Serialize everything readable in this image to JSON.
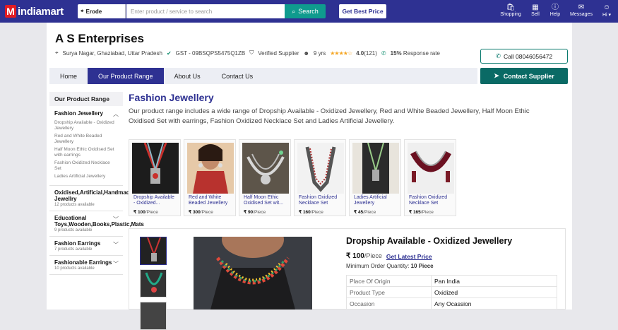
{
  "header": {
    "logo_text": "indiamart",
    "location": "Erode",
    "search_placeholder": "Enter product / service to search",
    "search_button": "Search",
    "best_price_button": "Get Best Price",
    "nav": [
      {
        "label": "Shopping",
        "icon": "cart-icon"
      },
      {
        "label": "Sell",
        "icon": "store-icon"
      },
      {
        "label": "Help",
        "icon": "help-icon"
      },
      {
        "label": "Messages",
        "icon": "messages-icon"
      },
      {
        "label": "Hi",
        "icon": "user-icon"
      }
    ]
  },
  "company": {
    "name": "A S Enterprises",
    "address": "Surya Nagar, Ghaziabad, Uttar Pradesh",
    "gst": "GST - 09BSQPS5475Q1ZB",
    "verified": "Verified Supplier",
    "years": "9 yrs",
    "rating": "4.0",
    "rating_count": "(121)",
    "response_pct": "15%",
    "response_label": "Response rate",
    "call_button": "Call 08046056472",
    "contact_button": "Contact Supplier"
  },
  "tabs": [
    "Home",
    "Our Product Range",
    "About Us",
    "Contact Us"
  ],
  "sidebar": {
    "heading": "Our Product Range",
    "categories": [
      {
        "title": "Fashion Jewellery",
        "count": "",
        "subs": [
          "Dropship Available - Oxidized Jewellery",
          "Red and White Beaded Jewellery",
          "Half Moon Ethic Oxidised Set with earrings",
          "Fashion Oxidized Necklace Set",
          "Ladies Artificial Jewellery"
        ]
      },
      {
        "title": "Oxidised,Artificial,Handmade Jewellry",
        "count": "12 products available",
        "subs": []
      },
      {
        "title": "Educational Toys,Wooden,Books,Plastic,Mats",
        "count": "9 products available",
        "subs": []
      },
      {
        "title": "Fashion Earrings",
        "count": "7 products available",
        "subs": []
      },
      {
        "title": "Fashionable Earrings",
        "count": "10 products available",
        "subs": []
      }
    ]
  },
  "main": {
    "heading": "Fashion Jewellery",
    "description": "Our product range includes a wide range of Dropship Available - Oxidized Jewellery, Red and White Beaded Jewellery, Half Moon Ethic Oxidised Set with earrings, Fashion Oxidized Necklace Set and Ladies Artificial Jewellery.",
    "products": [
      {
        "name": "Dropship Available - Oxidized...",
        "price": "₹ 100",
        "unit": "/Piece"
      },
      {
        "name": "Red and White Beaded Jewellery",
        "price": "₹ 300",
        "unit": "/Piece"
      },
      {
        "name": "Half Moon Ethic Oxidised Set wit...",
        "price": "₹ 90",
        "unit": "/Piece"
      },
      {
        "name": "Fashion Oxidized Necklace Set",
        "price": "₹ 160",
        "unit": "/Piece"
      },
      {
        "name": "Ladies Artificial Jewellery",
        "price": "₹ 45",
        "unit": "/Piece"
      },
      {
        "name": "Fashion Oxidized Necklace Set",
        "price": "₹ 165",
        "unit": "/Piece"
      }
    ]
  },
  "detail": {
    "title": "Dropship Available - Oxidized Jewellery",
    "price": "₹ 100",
    "unit": "/Piece",
    "latest_price_link": "Get Latest Price",
    "moq_label": "Minimum Order Quantity:",
    "moq_value": "10 Piece",
    "specs": [
      {
        "k": "Place Of Origin",
        "v": "Pan India"
      },
      {
        "k": "Product Type",
        "v": "Oxidized"
      },
      {
        "k": "Occasion",
        "v": "Any Ocassion"
      }
    ]
  }
}
